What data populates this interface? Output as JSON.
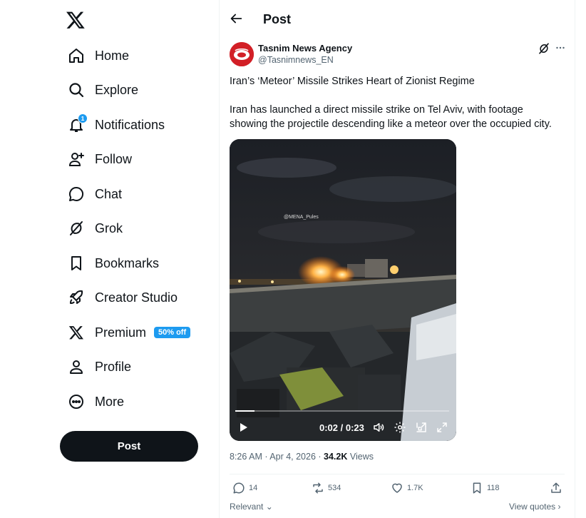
{
  "nav": {
    "logo": "x-logo-icon",
    "items": [
      {
        "label": "Home",
        "icon": "home-icon"
      },
      {
        "label": "Explore",
        "icon": "search-icon"
      },
      {
        "label": "Notifications",
        "icon": "bell-icon",
        "badge": "1"
      },
      {
        "label": "Follow",
        "icon": "person-add-icon"
      },
      {
        "label": "Chat",
        "icon": "chat-bubble-icon"
      },
      {
        "label": "Grok",
        "icon": "grok-icon"
      },
      {
        "label": "Bookmarks",
        "icon": "bookmark-icon"
      },
      {
        "label": "Creator Studio",
        "icon": "rocket-icon"
      },
      {
        "label": "Premium",
        "icon": "x-premium-icon",
        "promo": "50% off"
      },
      {
        "label": "Profile",
        "icon": "person-icon"
      },
      {
        "label": "More",
        "icon": "more-circle-icon"
      }
    ],
    "post_button": "Post"
  },
  "header": {
    "title": "Post"
  },
  "tweet": {
    "author_name": "Tasnim News Agency",
    "author_handle": "@Tasnimnews_EN",
    "headline": "Iran’s ‘Meteor’ Missile Strikes Heart of Zionist Regime",
    "body_line1": "Iran has launched a direct missile strike on Tel Aviv, with footage",
    "body_line2": "showing the projectile descending like a meteor over the occupied city.",
    "video": {
      "watermark": "@MENA_Pules",
      "time": "0:02 / 0:23",
      "progress_fraction": 0.09
    },
    "timestamp": "8:26 AM · Apr 4, 2026 · ",
    "views_count": "34.2K",
    "views_label": " Views",
    "actions": {
      "replies": "14",
      "reposts": "534",
      "likes": "1.7K",
      "bookmarks": "118"
    },
    "sort_label": "Relevant",
    "quotes_label": "View quotes"
  },
  "colors": {
    "accent": "#1d9bf0",
    "text": "#0f1419",
    "muted": "#536471",
    "avatar_red": "#d21f26"
  }
}
